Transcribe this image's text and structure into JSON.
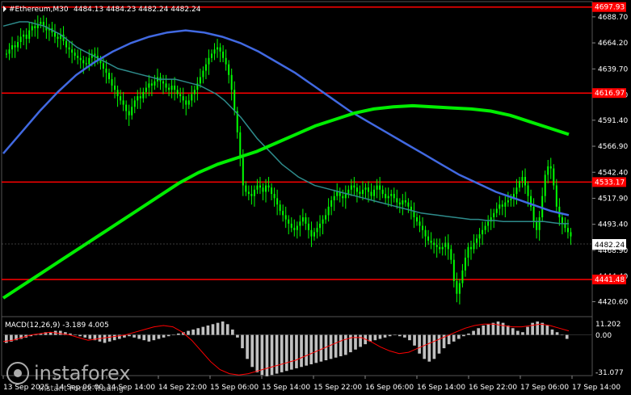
{
  "header": {
    "symbol_label": "#Ethereum,M30",
    "ohlc_text": "4484.13 4484.23 4482.24 4482.24"
  },
  "macd": {
    "label": "MACD(12,26,9) -3.189 4.005",
    "scale_top": "11.202",
    "scale_zero": "0.00",
    "scale_bottom": "-31.077"
  },
  "price_axis": {
    "ticks": [
      "4688.70",
      "4664.20",
      "4639.70",
      "4615.20",
      "4591.40",
      "4566.90",
      "4542.40",
      "4517.90",
      "4493.40",
      "4468.90",
      "4444.40",
      "4420.60"
    ],
    "current_price": "4482.24",
    "level_labels": [
      "4697.93",
      "4616.97",
      "4533.17",
      "4441.48"
    ]
  },
  "time_axis": {
    "labels": [
      "13 Sep 2025",
      "14 Sep 06:00",
      "14 Sep 14:00",
      "14 Sep 22:00",
      "15 Sep 06:00",
      "15 Sep 14:00",
      "15 Sep 22:00",
      "16 Sep 06:00",
      "16 Sep 14:00",
      "16 Sep 22:00",
      "17 Sep 06:00",
      "17 Sep 14:00"
    ]
  },
  "watermark": {
    "brand": "instaforex",
    "tagline": "Instant Forex Trading"
  },
  "colors": {
    "background": "#000000",
    "candles": "#00ff00",
    "level_lines": "#ff0000",
    "ma_fast": "#2e8b8b",
    "ma_mid": "#4169e1",
    "ma_slow": "#00ee00",
    "macd_hist": "#c0c0c0",
    "macd_signal": "#ff0000",
    "current_price_box": "#ffffff",
    "level_box": "#ff0000"
  },
  "chart_data": {
    "type": "candlestick",
    "symbol": "#Ethereum",
    "timeframe": "M30",
    "price_range": [
      4408,
      4700
    ],
    "horizontal_levels": [
      4697.93,
      4616.97,
      4533.17,
      4441.48
    ],
    "last_price": 4482.24,
    "close_series": [
      4654,
      4658,
      4662,
      4660,
      4665,
      4670,
      4672,
      4668,
      4676,
      4680,
      4678,
      4682,
      4684,
      4680,
      4676,
      4678,
      4674,
      4670,
      4668,
      4672,
      4666,
      4660,
      4658,
      4655,
      4652,
      4650,
      4648,
      4645,
      4644,
      4650,
      4654,
      4652,
      4648,
      4645,
      4640,
      4636,
      4630,
      4624,
      4620,
      4614,
      4610,
      4606,
      4600,
      4596,
      4604,
      4610,
      4614,
      4612,
      4618,
      4622,
      4626,
      4624,
      4628,
      4632,
      4628,
      4626,
      4622,
      4620,
      4624,
      4620,
      4616,
      4614,
      4610,
      4606,
      4610,
      4616,
      4620,
      4626,
      4632,
      4638,
      4644,
      4650,
      4654,
      4658,
      4660,
      4656,
      4650,
      4644,
      4634,
      4620,
      4600,
      4580,
      4556,
      4530,
      4524,
      4522,
      4520,
      4526,
      4530,
      4528,
      4524,
      4530,
      4528,
      4522,
      4518,
      4512,
      4506,
      4502,
      4498,
      4494,
      4490,
      4488,
      4492,
      4496,
      4500,
      4494,
      4488,
      4482,
      4486,
      4490,
      4494,
      4498,
      4502,
      4510,
      4516,
      4520,
      4524,
      4520,
      4518,
      4522,
      4526,
      4530,
      4528,
      4524,
      4522,
      4526,
      4528,
      4524,
      4520,
      4526,
      4530,
      4526,
      4522,
      4518,
      4520,
      4522,
      4518,
      4514,
      4512,
      4516,
      4514,
      4510,
      4506,
      4500,
      4496,
      4492,
      4488,
      4482,
      4478,
      4476,
      4474,
      4472,
      4470,
      4472,
      4476,
      4470,
      4460,
      4440,
      4428,
      4438,
      4450,
      4462,
      4472,
      4470,
      4476,
      4480,
      4484,
      4488,
      4492,
      4496,
      4500,
      4504,
      4508,
      4512,
      4510,
      4514,
      4516,
      4518,
      4522,
      4528,
      4534,
      4538,
      4530,
      4520,
      4510,
      4496,
      4488,
      4500,
      4520,
      4540,
      4548,
      4546,
      4530,
      4510,
      4500,
      4494,
      4490,
      4486,
      4482
    ],
    "ma_fast_series": [
      4680,
      4682,
      4684,
      4684,
      4682,
      4680,
      4676,
      4672,
      4666,
      4660,
      4656,
      4652,
      4648,
      4644,
      4640,
      4638,
      4636,
      4634,
      4632,
      4630,
      4630,
      4630,
      4628,
      4626,
      4624,
      4620,
      4616,
      4610,
      4602,
      4594,
      4584,
      4574,
      4566,
      4558,
      4550,
      4544,
      4538,
      4534,
      4530,
      4528,
      4526,
      4524,
      4522,
      4520,
      4518,
      4516,
      4514,
      4512,
      4510,
      4508,
      4506,
      4504,
      4503,
      4502,
      4501,
      4500,
      4499,
      4498,
      4498,
      4497,
      4497,
      4496,
      4496,
      4496,
      4496,
      4496,
      4496,
      4495,
      4494,
      4494
    ],
    "ma_mid_series": [
      4560,
      4580,
      4600,
      4618,
      4634,
      4646,
      4656,
      4664,
      4670,
      4674,
      4676,
      4674,
      4670,
      4664,
      4656,
      4646,
      4636,
      4624,
      4612,
      4600,
      4590,
      4580,
      4570,
      4560,
      4550,
      4540,
      4532,
      4524,
      4518,
      4512,
      4506,
      4502
    ],
    "ma_slow_series": [
      4424,
      4436,
      4448,
      4460,
      4472,
      4484,
      4496,
      4508,
      4520,
      4532,
      4542,
      4550,
      4556,
      4562,
      4570,
      4578,
      4586,
      4592,
      4598,
      4602,
      4604,
      4605,
      4604,
      4603,
      4602,
      4600,
      4596,
      4590,
      4584,
      4578
    ],
    "macd_histogram": [
      -6,
      -5,
      -4,
      -3,
      -2,
      -1,
      0,
      1,
      2,
      2,
      3,
      3,
      2,
      1,
      0,
      -1,
      -2,
      -3,
      -4,
      -5,
      -6,
      -5,
      -4,
      -3,
      -2,
      -1,
      -2,
      -3,
      -4,
      -5,
      -4,
      -3,
      -2,
      -1,
      0,
      1,
      2,
      3,
      4,
      5,
      6,
      7,
      8,
      9,
      10,
      8,
      4,
      -2,
      -10,
      -18,
      -24,
      -28,
      -30,
      -31,
      -30,
      -29,
      -28,
      -27,
      -26,
      -25,
      -24,
      -23,
      -22,
      -21,
      -20,
      -19,
      -18,
      -17,
      -16,
      -15,
      -13,
      -11,
      -9,
      -7,
      -5,
      -4,
      -3,
      -2,
      -1,
      0,
      -1,
      -2,
      -4,
      -8,
      -14,
      -18,
      -20,
      -18,
      -14,
      -10,
      -7,
      -5,
      -3,
      -1,
      1,
      3,
      5,
      7,
      8,
      9,
      10,
      9,
      7,
      5,
      3,
      2,
      6,
      9,
      10,
      9,
      7,
      4,
      2,
      0,
      -3
    ],
    "macd_signal_series": [
      -5,
      -4,
      -2,
      0,
      1,
      2,
      1,
      0,
      -2,
      -4,
      -3,
      -2,
      -1,
      0,
      2,
      4,
      6,
      7,
      6,
      2,
      -4,
      -12,
      -20,
      -26,
      -29,
      -30,
      -29,
      -27,
      -25,
      -23,
      -21,
      -19,
      -16,
      -13,
      -10,
      -7,
      -4,
      -2,
      -2,
      -5,
      -9,
      -12,
      -14,
      -13,
      -10,
      -7,
      -4,
      -1,
      2,
      5,
      7,
      8,
      8,
      7,
      6,
      6,
      7,
      8,
      7,
      5,
      3
    ]
  }
}
